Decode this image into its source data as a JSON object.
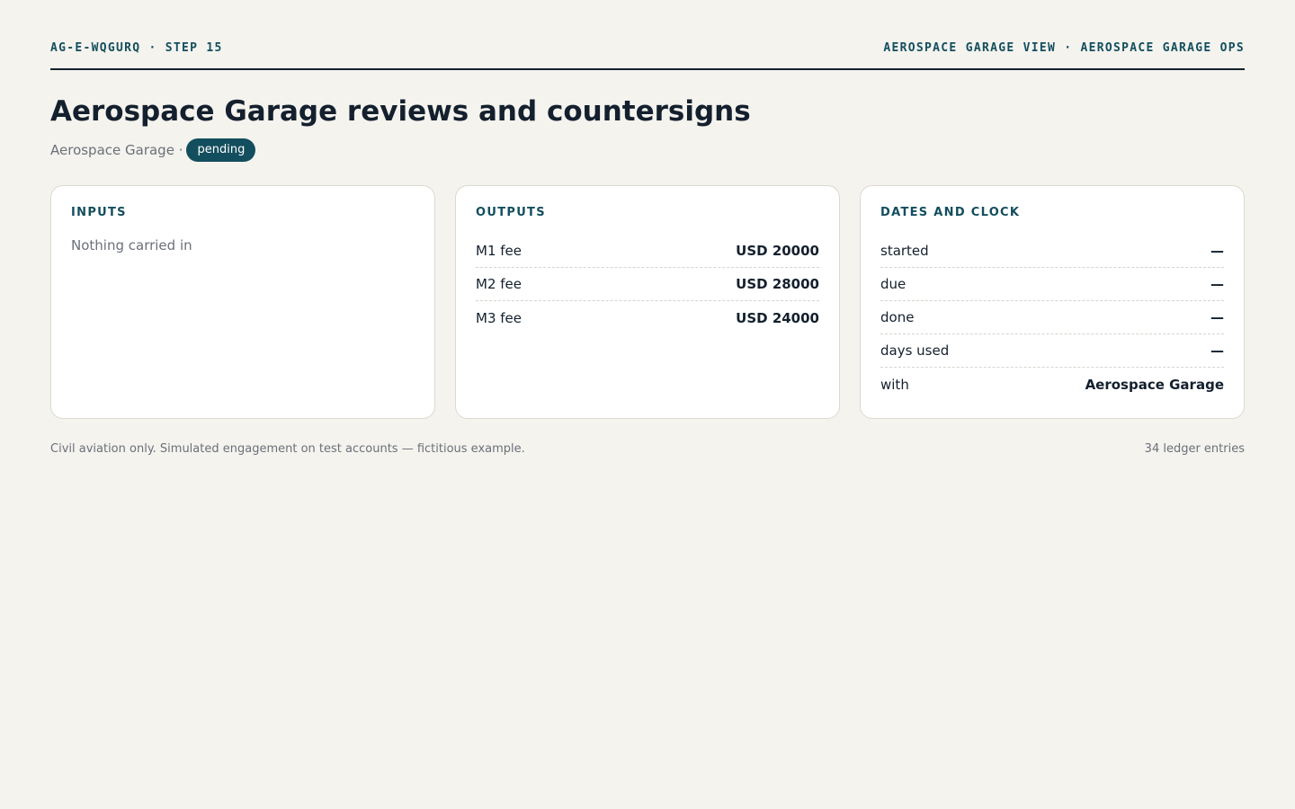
{
  "header": {
    "left_label": "AG-E-WQGURQ · STEP 15",
    "right_label": "AEROSPACE GARAGE VIEW · AEROSPACE GARAGE OPS"
  },
  "page": {
    "title": "Aerospace Garage reviews and countersigns",
    "subtitle_owner": "Aerospace Garage ·",
    "status": "pending"
  },
  "inputs": {
    "title": "INPUTS",
    "empty_text": "Nothing carried in"
  },
  "outputs": {
    "title": "OUTPUTS",
    "rows": [
      {
        "label": "M1 fee",
        "value": "USD 20000"
      },
      {
        "label": "M2 fee",
        "value": "USD 28000"
      },
      {
        "label": "M3 fee",
        "value": "USD 24000"
      }
    ]
  },
  "dates": {
    "title": "DATES AND CLOCK",
    "rows": [
      {
        "label": "started",
        "value": "—"
      },
      {
        "label": "due",
        "value": "—"
      },
      {
        "label": "done",
        "value": "—"
      },
      {
        "label": "days used",
        "value": "—"
      },
      {
        "label": "with",
        "value": "Aerospace Garage"
      }
    ]
  },
  "footer": {
    "disclaimer": "Civil aviation only. Simulated engagement on test accounts — fictitious example.",
    "ledger_count": "34 ledger entries"
  },
  "colors": {
    "background": "#f4f3ee",
    "accent": "#134e5e",
    "text": "#14202e",
    "muted": "#6b7079"
  }
}
